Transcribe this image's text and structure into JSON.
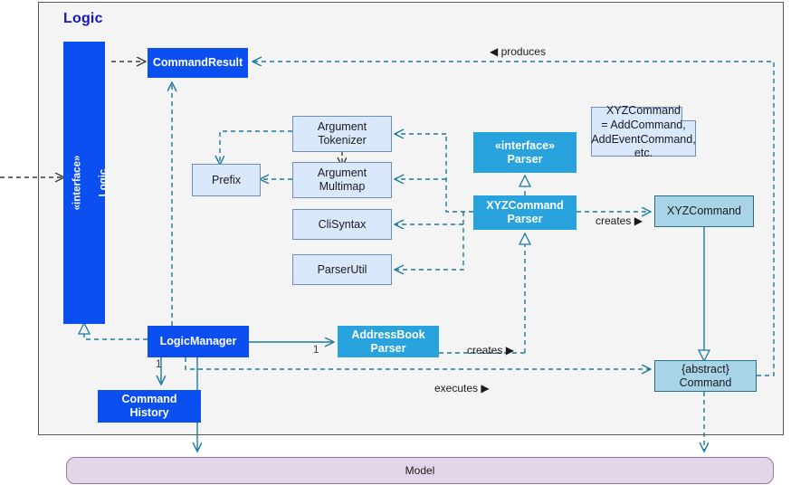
{
  "panel": {
    "title": "Logic"
  },
  "nodes": {
    "logic_interface": {
      "stereotype": "«interface»",
      "name": "Logic"
    },
    "command_result": {
      "label": "CommandResult"
    },
    "argument_tokenizer": {
      "label": "Argument\nTokenizer"
    },
    "prefix": {
      "label": "Prefix"
    },
    "argument_multimap": {
      "label": "Argument\nMultimap"
    },
    "cli_syntax": {
      "label": "CliSyntax"
    },
    "parser_util": {
      "label": "ParserUtil"
    },
    "parser_interface": {
      "label": "«interface»\nParser"
    },
    "xyz_command_parser": {
      "label": "XYZCommand\nParser"
    },
    "xyz_command": {
      "label": "XYZCommand"
    },
    "logic_manager": {
      "label": "LogicManager"
    },
    "address_book_parser": {
      "label": "AddressBook\nParser"
    },
    "command_history": {
      "label": "Command\nHistory"
    },
    "abstract_command": {
      "label": "{abstract}\nCommand"
    },
    "model": {
      "label": "Model"
    }
  },
  "note": {
    "text": "XYZCommand\n= AddCommand,\nAddEventCommand,\netc."
  },
  "edge_labels": {
    "produces": "produces",
    "creates_parser": "creates",
    "creates_abp": "creates",
    "executes": "executes"
  },
  "multiplicities": {
    "logic_manager_to_abp": "1",
    "logic_manager_to_history": "1"
  },
  "colors": {
    "panel_bg": "#f4f4f4",
    "panel_border": "#59595a",
    "title": "#1414c8",
    "strong_blue": "#0b4ff0",
    "cyan": "#28a3dd",
    "pale_blue_fill": "#dae8fc",
    "pale_blue_border": "#6c8ebf",
    "medium_blue_fill": "#a8d4e8",
    "medium_blue_border": "#2b6f8c",
    "model_fill": "#e1d5e7",
    "model_border": "#9673a6",
    "wire": "#1a7a9e",
    "wire_dark": "#3c3c3c"
  }
}
